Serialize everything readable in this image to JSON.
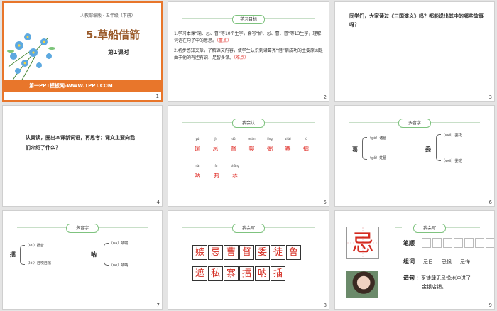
{
  "slides": [
    {
      "num": "1",
      "subtitle": "人教部编版 · 五年级（下册）",
      "title": "5.草船借箭",
      "lesson": "第1课时",
      "footer": "第一PPT模板网-WWW.1PPT.COM"
    },
    {
      "num": "2",
      "tag": "学习目标",
      "line1": "1.学习本课“瑜、忌、督”等10个生字，会写“妒、忌、曹、督”等13生字，理解词语在句子中的意思。",
      "line1_tag": "（重点）",
      "line2": "2.初步感知文章，了解课文内容，使学生认识到诸葛亮“借”箭成功的主要原因是由于他的有胆有识、足智多谋。",
      "line2_tag": "（难点）"
    },
    {
      "num": "3",
      "text": "同学们，大家读过《三国演义》吗？都能说出其中的哪些故事呀？"
    },
    {
      "num": "4",
      "text": "认真读，圈出本课新词语，再思考：课文主要向我们介绍了什么？"
    },
    {
      "num": "5",
      "tag": "我会认",
      "row1_pinyin": [
        "yú",
        "jì",
        "dū",
        "mián",
        "líng",
        "zhài",
        "lù"
      ],
      "row1_chars": [
        "瑜",
        "忌",
        "督",
        "幔",
        "弼",
        "寨",
        "擂"
      ],
      "row2_pinyin": [
        "nà",
        "fú",
        "shāng"
      ],
      "row2_chars": [
        "呐",
        "弗",
        "丞"
      ]
    },
    {
      "num": "6",
      "tag": "多音字",
      "group1_char": "葛",
      "group1_items": [
        "（gé）诸葛",
        "（gě）姓葛"
      ],
      "group2_char": "委",
      "group2_items": [
        "（wěi）委托",
        "（wēi）委蛇"
      ]
    },
    {
      "num": "7",
      "tag": "多音字",
      "group1_char": "擂",
      "group1_items": [
        "（lèi）擂台",
        "（léi）自吹自擂"
      ],
      "group2_char": "呐",
      "group2_items": [
        "（nà）呐喊",
        "（nè）呐呐"
      ]
    },
    {
      "num": "8",
      "tag": "我会写",
      "row1": [
        "嫉",
        "忌",
        "曹",
        "督",
        "委",
        "徒",
        "鲁"
      ],
      "row2": [
        "遮",
        "私",
        "寨",
        "擂",
        "呐",
        "插"
      ]
    },
    {
      "num": "9",
      "tag": "我会写",
      "big_char": "忌",
      "label_order": "笔顺",
      "label_words": "组词",
      "words": [
        "忌日",
        "忌恨",
        "忌惮"
      ],
      "label_sentence": "造句",
      "sentence_line1": "：歹徒肆无忌惮地冲进了",
      "sentence_line2": "金银店铺。"
    }
  ],
  "colors": {
    "accent": "#e8762b",
    "title_brown": "#9a5b2b",
    "red": "#e0302a",
    "tag_border": "#7fc37f"
  }
}
